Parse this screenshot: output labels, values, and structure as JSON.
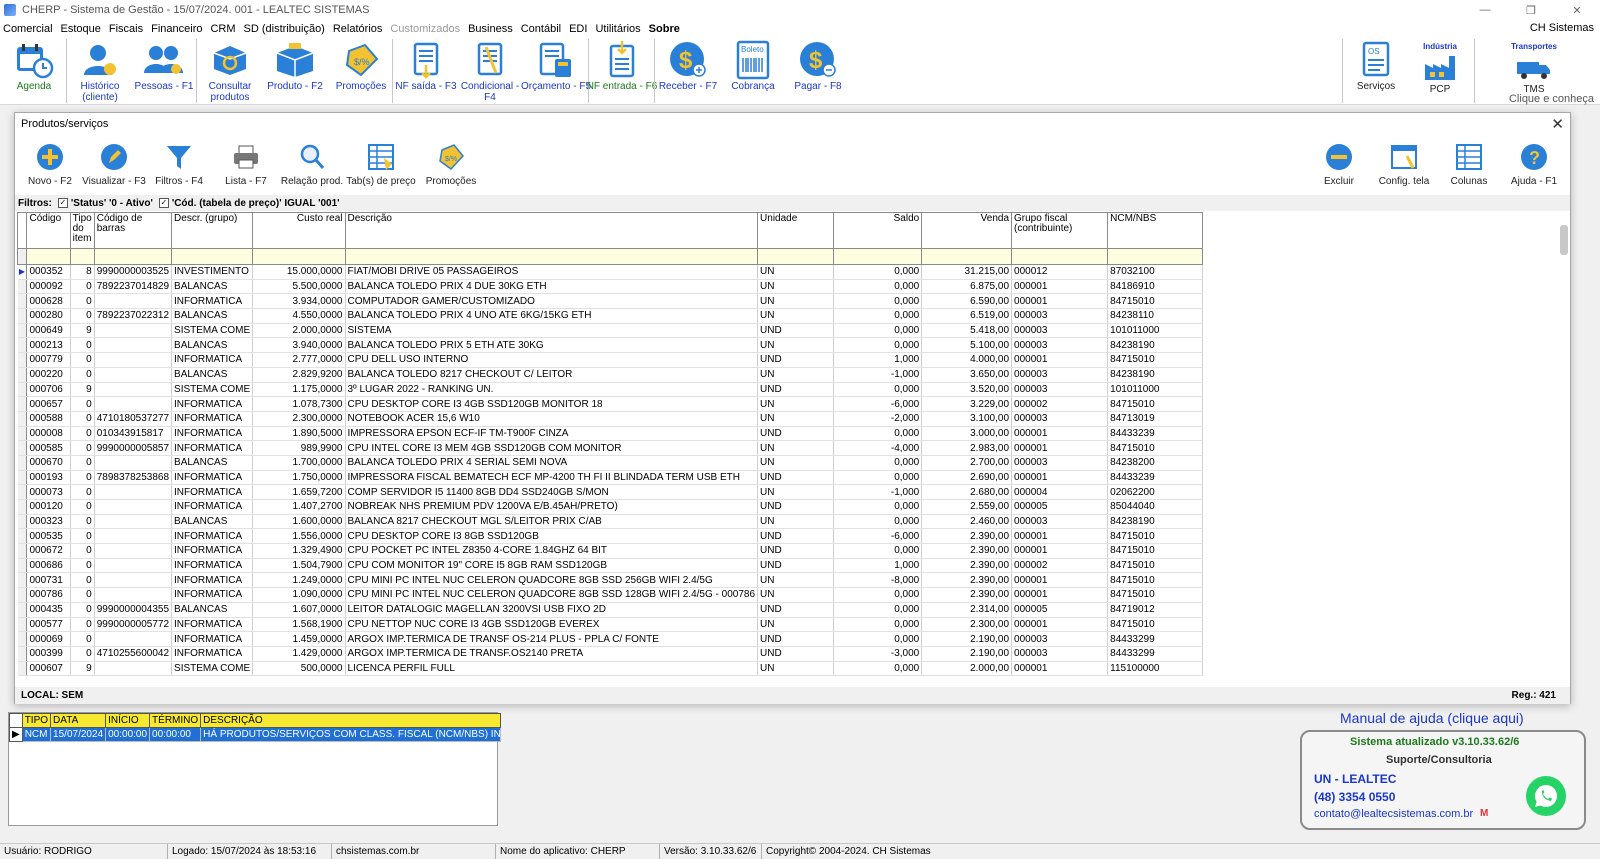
{
  "window": {
    "title": "CHERP - Sistema de Gestão - 15/07/2024. 001 - LEALTEC SISTEMAS"
  },
  "menu": {
    "items": [
      {
        "label": "Comercial"
      },
      {
        "label": "Estoque"
      },
      {
        "label": "Fiscais"
      },
      {
        "label": "Financeiro"
      },
      {
        "label": "CRM"
      },
      {
        "label": "SD (distribuição)"
      },
      {
        "label": "Relatórios"
      },
      {
        "label": "Customizados",
        "disabled": true
      },
      {
        "label": "Business"
      },
      {
        "label": "Contábil"
      },
      {
        "label": "EDI"
      },
      {
        "label": "Utilitários"
      },
      {
        "label": "Sobre",
        "bold": true
      }
    ],
    "company": "CH Sistemas"
  },
  "toolbar": {
    "agenda": "Agenda",
    "historico": "Histórico (cliente)",
    "pessoas": "Pessoas - F1",
    "consultar": "Consultar produtos",
    "produto": "Produto - F2",
    "promocoes": "Promoções",
    "nf_saida": "NF saída - F3",
    "condicional": "Condicional - F4",
    "orcamento": "Orçamento - F5",
    "nf_entrada": "NF entrada - F6",
    "receber": "Receber - F7",
    "cobranca": "Cobrança",
    "pagar": "Pagar - F8",
    "servicos": "Serviços",
    "pcp": "PCP",
    "pcp_top": "Indústria",
    "tms": "TMS",
    "tms_top": "Transportes",
    "tms_note": "Clique e conheça",
    "boleto_text": "Boleto",
    "os_text": "OS"
  },
  "product_window": {
    "title": "Produtos/serviços",
    "tools": {
      "novo": "Novo - F2",
      "visualizar": "Visualizar - F3",
      "filtros": "Filtros - F4",
      "lista": "Lista - F7",
      "relacao": "Relação prod.",
      "tabs": "Tab(s) de preço",
      "promocoes": "Promoções",
      "excluir": "Excluir",
      "config": "Config. tela",
      "colunas": "Colunas",
      "ajuda": "Ajuda - F1"
    },
    "filters_label": "Filtros:",
    "filter1": "'Status' '0 - Ativo'",
    "filter2": "'Cód. (tabela de preço)' IGUAL '001'",
    "columns": [
      "Código",
      "Tipo do item",
      "Código de barras",
      "Descr. (grupo)",
      "Custo real",
      "Descrição",
      "Unidade",
      "Saldo",
      "Venda",
      "Grupo fiscal (contribuinte)",
      "NCM/NBS"
    ],
    "rows": [
      [
        "000352",
        "8",
        "9990000003525",
        "INVESTIMENTO",
        "15.000,0000",
        "FIAT/MOBI DRIVE            05 PASSAGEIROS",
        "UN",
        "0,000",
        "31.215,00",
        "000012",
        "87032100"
      ],
      [
        "000092",
        "0",
        "7892237014829",
        "BALANCAS",
        "5.500,0000",
        "BALANCA TOLEDO PRIX 4 DUE 30KG ETH",
        "UN",
        "0,000",
        "6.875,00",
        "000001",
        "84186910"
      ],
      [
        "000628",
        "0",
        "",
        "INFORMATICA",
        "3.934,0000",
        "COMPUTADOR GAMER/CUSTOMIZADO",
        "UN",
        "0,000",
        "6.590,00",
        "000001",
        "84715010"
      ],
      [
        "000280",
        "0",
        "7892237022312",
        "BALANCAS",
        "4.550,0000",
        "BALANCA TOLEDO PRIX 4 UNO ATE 6KG/15KG ETH",
        "UN",
        "0,000",
        "6.519,00",
        "000003",
        "84238110"
      ],
      [
        "000649",
        "9",
        "",
        "SISTEMA COME",
        "2.000,0000",
        "SISTEMA",
        "UND",
        "0,000",
        "5.418,00",
        "000003",
        "101011000"
      ],
      [
        "000213",
        "0",
        "",
        "BALANCAS",
        "3.940,0000",
        "BALANCA TOLEDO PRIX 5 ETH ATE 30KG",
        "UN",
        "0,000",
        "5.100,00",
        "000003",
        "84238190"
      ],
      [
        "000779",
        "0",
        "",
        "INFORMATICA",
        "2.777,0000",
        "CPU DELL USO INTERNO",
        "UND",
        "1,000",
        "4.000,00",
        "000001",
        "84715010"
      ],
      [
        "000220",
        "0",
        "",
        "BALANCAS",
        "2.829,9200",
        "BALANCA TOLEDO  8217 CHECKOUT C/ LEITOR",
        "UN",
        "-1,000",
        "3.650,00",
        "000003",
        "84238190"
      ],
      [
        "000706",
        "9",
        "",
        "SISTEMA COME",
        "1.175,0000",
        "3º LUGAR 2022 - RANKING UN.",
        "UND",
        "0,000",
        "3.520,00",
        "000003",
        "101011000"
      ],
      [
        "000657",
        "0",
        "",
        "INFORMATICA",
        "1.078,7300",
        "CPU DESKTOP CORE I3 4GB SSD120GB MONITOR 18",
        "UN",
        "-6,000",
        "3.229,00",
        "000002",
        "84715010"
      ],
      [
        "000588",
        "0",
        "4710180537277",
        "INFORMATICA",
        "2.300,0000",
        "NOTEBOOK ACER 15,6 W10",
        "UN",
        "-2,000",
        "3.100,00",
        "000003",
        "84713019"
      ],
      [
        "000008",
        "0",
        "010343915817",
        "INFORMATICA",
        "1.890,5000",
        "IMPRESSORA EPSON ECF-IF TM-T900F CINZA",
        "UND",
        "0,000",
        "3.000,00",
        "000001",
        "84433239"
      ],
      [
        "000585",
        "0",
        "9990000005857",
        "INFORMATICA",
        "989,9900",
        "CPU INTEL  CORE I3 MEM 4GB  SSD120GB COM MONITOR",
        "UN",
        "-4,000",
        "2.983,00",
        "000001",
        "84715010"
      ],
      [
        "000670",
        "0",
        "",
        "BALANCAS",
        "1.700,0000",
        "BALANCA TOLEDO PRIX 4 SERIAL SEMI NOVA",
        "UN",
        "0,000",
        "2.700,00",
        "000003",
        "84238200"
      ],
      [
        "000193",
        "0",
        "7898378253868",
        "INFORMATICA",
        "1.750,0000",
        "IMPRESSORA FISCAL BEMATECH ECF MP-4200 TH FI II BLINDADA TERM USB ETH",
        "UND",
        "0,000",
        "2.690,00",
        "000001",
        "84433239"
      ],
      [
        "000073",
        "0",
        "",
        "INFORMATICA",
        "1.659,7200",
        "COMP SERVIDOR I5 11400  8GB DD4 SSD240GB S/MON",
        "UN",
        "-1,000",
        "2.680,00",
        "000004",
        "02062200"
      ],
      [
        "000120",
        "0",
        "",
        "INFORMATICA",
        "1.407,2700",
        "NOBREAK NHS PREMIUM PDV 1200VA E/B.45AH/PRETO)",
        "UND",
        "0,000",
        "2.559,00",
        "000005",
        "85044040"
      ],
      [
        "000323",
        "0",
        "",
        "BALANCAS",
        "1.600,0000",
        "BALANCA 8217 CHECKOUT MGL S/LEITOR PRIX C/AB",
        "UN",
        "0,000",
        "2.460,00",
        "000003",
        "84238190"
      ],
      [
        "000535",
        "0",
        "",
        "INFORMATICA",
        "1.556,0000",
        "CPU DESKTOP CORE I3 8GB SSD120GB",
        "UND",
        "-6,000",
        "2.390,00",
        "000001",
        "84715010"
      ],
      [
        "000672",
        "0",
        "",
        "INFORMATICA",
        "1.329,4900",
        "CPU POCKET PC INTEL Z8350 4-CORE 1.84GHZ 64 BIT",
        "UND",
        "0,000",
        "2.390,00",
        "000001",
        "84715010"
      ],
      [
        "000686",
        "0",
        "",
        "INFORMATICA",
        "1.504,7900",
        "CPU COM MONITOR 19\" CORE I5 8GB RAM SSD120GB",
        "UND",
        "1,000",
        "2.390,00",
        "000002",
        "84715010"
      ],
      [
        "000731",
        "0",
        "",
        "INFORMATICA",
        "1.249,0000",
        "CPU MINI PC INTEL NUC CELERON QUADCORE 8GB SSD 256GB WIFI 2.4/5G",
        "UN",
        "-8,000",
        "2.390,00",
        "000001",
        "84715010"
      ],
      [
        "000786",
        "0",
        "",
        "INFORMATICA",
        "1.090,0000",
        "CPU MINI PC INTEL NUC CELERON QUADCORE 8GB SSD 128GB WIFI 2.4/5G - 000786",
        "UN",
        "0,000",
        "2.390,00",
        "000001",
        "84715010"
      ],
      [
        "000435",
        "0",
        "9990000004355",
        "BALANCAS",
        "1.607,0000",
        "LEITOR DATALOGIC MAGELLAN 3200VSI USB FIXO 2D",
        "UND",
        "0,000",
        "2.314,00",
        "000005",
        "84719012"
      ],
      [
        "000577",
        "0",
        "9990000005772",
        "INFORMATICA",
        "1.568,1900",
        "CPU NETTOP NUC CORE I3 4GB SSD120GB EVEREX",
        "UN",
        "0,000",
        "2.300,00",
        "000001",
        "84715010"
      ],
      [
        "000069",
        "0",
        "",
        "INFORMATICA",
        "1.459,0000",
        "ARGOX IMP.TERMICA DE TRANSF OS-214 PLUS - PPLA C/ FONTE",
        "UND",
        "0,000",
        "2.190,00",
        "000003",
        "84433299"
      ],
      [
        "000399",
        "0",
        "4710255600042",
        "INFORMATICA",
        "1.429,0000",
        "ARGOX IMP.TERMICA DE TRANSF.OS2140 PRETA",
        "UND",
        "-3,000",
        "2.190,00",
        "000003",
        "84433299"
      ],
      [
        "000607",
        "9",
        "",
        "SISTEMA COME",
        "500,0000",
        "LICENCA PERFIL FULL",
        "UN",
        "0,000",
        "2.000,00",
        "000001",
        "115100000"
      ]
    ],
    "local": "LOCAL: SEM",
    "reg": "Reg.: 421"
  },
  "alerts": {
    "headers": [
      "TIPO",
      "DATA",
      "INÍCIO",
      "TÉRMINO",
      "DESCRIÇÃO"
    ],
    "row": [
      "NCM",
      "15/07/2024",
      "00:00:00",
      "00:00:00",
      "HÁ PRODUTOS/SERVIÇOS COM CLASS. FISCAL (NCM/NBS) INVÁLIDA"
    ]
  },
  "support": {
    "help_link": "Manual de ajuda (clique aqui)",
    "updated": "Sistema atualizado v3.10.33.62/6",
    "title": "Suporte/Consultoria",
    "unit": "UN - LEALTEC",
    "phone": "(48)   3354 0550",
    "email": "contato@lealtecsistemas.com.br"
  },
  "status": {
    "user": "Usuário: RODRIGO",
    "login": "Logado: 15/07/2024 às 18:53:16",
    "site": "chsistemas.com.br",
    "app": "Nome do aplicativo: CHERP",
    "version": "Versão: 3.10.33.62/6",
    "copyright": "Copyright© 2004-2024. CH Sistemas"
  },
  "colors": {
    "accent_blue": "#1a37c9",
    "alert_yellow": "#f7e92f",
    "selection_blue": "#1f6fd6",
    "green": "#1c7a1c"
  }
}
